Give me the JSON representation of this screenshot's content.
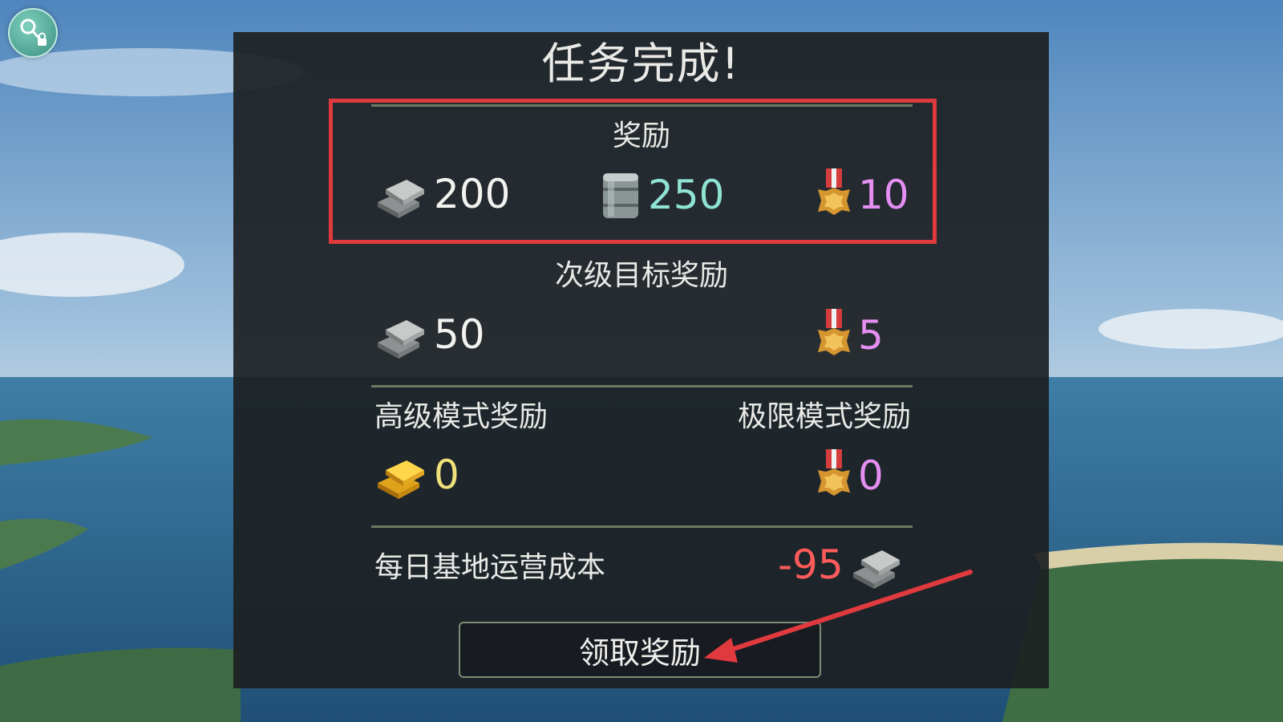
{
  "dialog": {
    "title": "任务完成!",
    "rewards": {
      "heading": "奖励",
      "silver": "200",
      "fuel": "250",
      "medals": "10"
    },
    "secondary": {
      "heading": "次级目标奖励",
      "silver": "50",
      "medals": "5"
    },
    "advanced": {
      "heading": "高级模式奖励",
      "gold": "0"
    },
    "extreme": {
      "heading": "极限模式奖励",
      "medals": "0"
    },
    "daily_cost": {
      "label": "每日基地运营成本",
      "value": "-95"
    },
    "collect_button": "领取奖励"
  },
  "icons": {
    "silver": "silver-bars-icon",
    "gold": "gold-bars-icon",
    "fuel": "fuel-barrel-icon",
    "medal": "iron-cross-medal-icon",
    "profile": "key-lock-icon"
  },
  "colors": {
    "highlight": "#e03a3f",
    "fuel_value": "#8fe3d3",
    "medal_value": "#e58ff2",
    "gold_value": "#f0e17a",
    "cost_value": "#ff5b5b"
  }
}
